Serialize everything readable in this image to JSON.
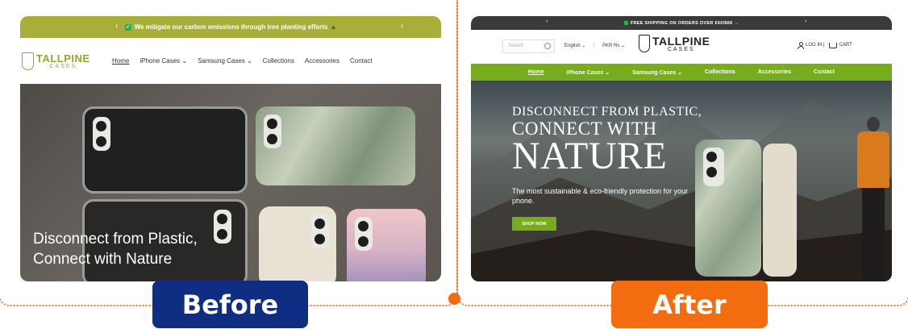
{
  "before": {
    "announcement": "We mitigate our carbon emissions through tree planting efforts",
    "logo": {
      "main": "TALLPINE",
      "sub": "CASES"
    },
    "nav": [
      "Home",
      "iPhone Cases",
      "Samsung Cases",
      "Collections",
      "Accessories",
      "Contact"
    ],
    "headline": "Disconnect from Plastic, Connect with Nature"
  },
  "after": {
    "announcement": "FREE SHIPPING ON ORDERS OVER €60/$66 →",
    "search_placeholder": "Search",
    "language": "English",
    "currency": "PKR Rs",
    "logo": {
      "main": "TALLPINE",
      "sub": "CASES"
    },
    "login": "LOG IN |",
    "cart": "CART",
    "nav": [
      "Home",
      "iPhone Cases",
      "Samsung Cases",
      "Collections",
      "Accessories",
      "Contact"
    ],
    "hero": {
      "line1": "DISCONNECT FROM PLASTIC,",
      "line2": "CONNECT WITH",
      "line3": "NATURE",
      "subtext": "The most sustainable & eco-friendly protection for your phone.",
      "cta": "SHOP NOW"
    }
  },
  "labels": {
    "before": "Before",
    "after": "After"
  },
  "colors": {
    "before_accent": "#a7ae3a",
    "after_accent": "#77ac1d",
    "before_label": "#0e2d83",
    "after_label": "#f36c0f"
  }
}
